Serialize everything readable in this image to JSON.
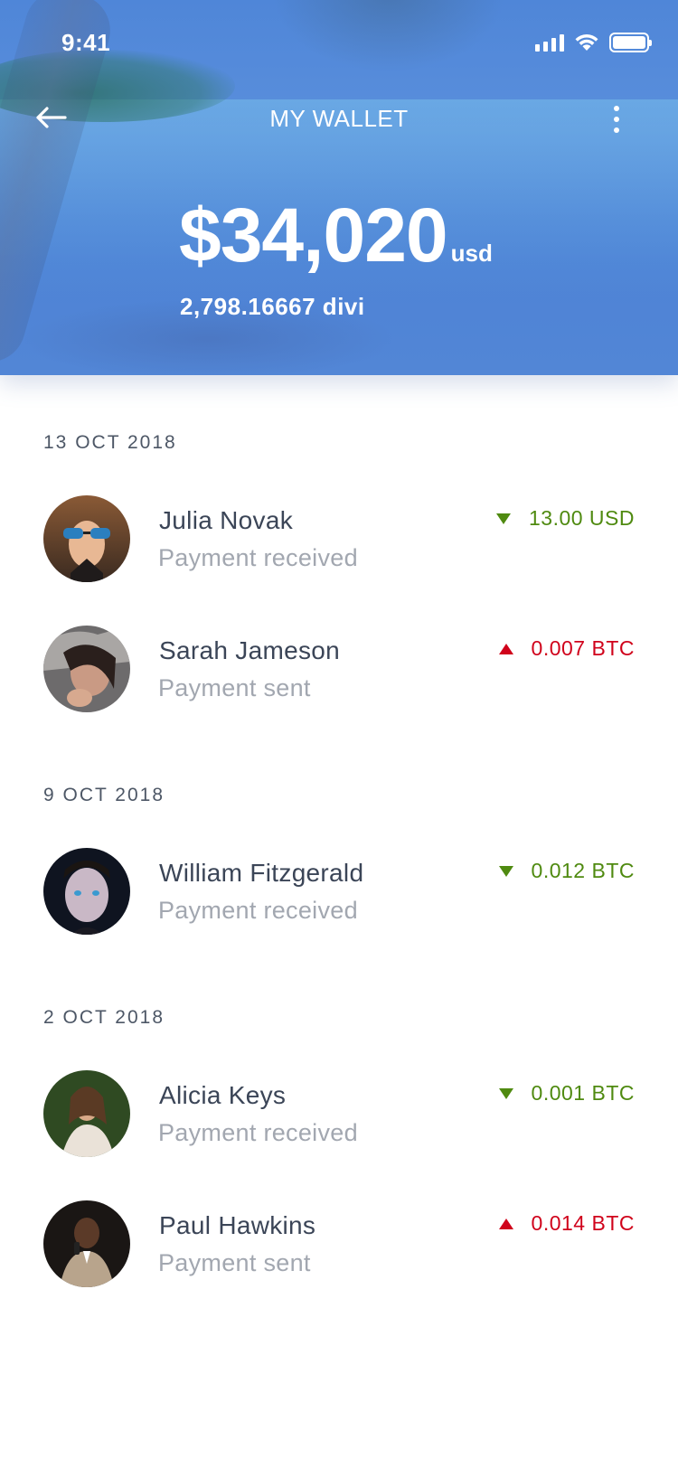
{
  "status_bar": {
    "time": "9:41"
  },
  "header": {
    "title": "MY WALLET",
    "balance_amount": "$34,020",
    "balance_unit": "usd",
    "balance_crypto": "2,798.16667 divi"
  },
  "sections": [
    {
      "date": "13 OCT 2018",
      "transactions": [
        {
          "name": "Julia Novak",
          "status": "Payment received",
          "amount": "13.00 USD",
          "direction": "in"
        },
        {
          "name": "Sarah Jameson",
          "status": "Payment sent",
          "amount": "0.007 BTC",
          "direction": "out"
        }
      ]
    },
    {
      "date": "9 OCT 2018",
      "transactions": [
        {
          "name": "William Fitzgerald",
          "status": "Payment received",
          "amount": "0.012 BTC",
          "direction": "in"
        }
      ]
    },
    {
      "date": "2 OCT 2018",
      "transactions": [
        {
          "name": "Alicia Keys",
          "status": "Payment received",
          "amount": "0.001 BTC",
          "direction": "in"
        },
        {
          "name": "Paul Hawkins",
          "status": "Payment sent",
          "amount": "0.014 BTC",
          "direction": "out"
        }
      ]
    }
  ],
  "colors": {
    "header_blue": "#5289d8",
    "received_green": "#4f8a10",
    "sent_red": "#d0021b",
    "name_text": "#3b4557",
    "sub_text": "#a2a7b0"
  },
  "icons": {
    "back": "arrow-left-icon",
    "more": "more-vertical-icon",
    "received": "triangle-down-icon",
    "sent": "triangle-up-icon"
  }
}
